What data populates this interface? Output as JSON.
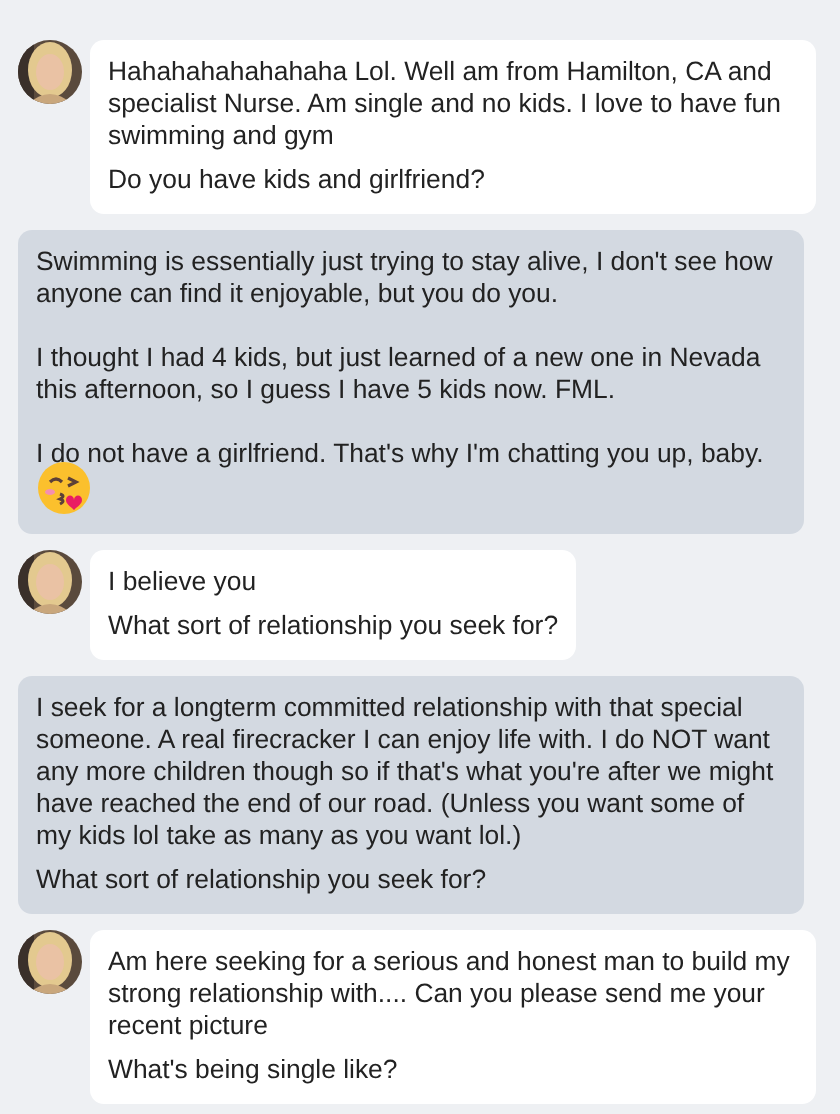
{
  "messages": [
    {
      "kind": "incoming",
      "paragraphs": [
        "Hahahahahahahaha Lol. Well am from Hamilton, CA and specialist Nurse. Am single and no kids. I love to have fun swimming and gym"
      ],
      "question": "Do you have kids and girlfriend?"
    },
    {
      "kind": "outgoing",
      "paragraphs": [
        "Swimming is essentially just trying to stay alive, I don't see how anyone can find it enjoyable, but you do you.",
        "I thought I had 4 kids, but just learned of a new one in Nevada this afternoon, so I guess I have 5 kids now. FML.",
        "I do not have a girlfriend. That's why I'm chatting you up, baby."
      ],
      "has_emoji": true
    },
    {
      "kind": "incoming",
      "paragraphs": [
        "I believe you"
      ],
      "question": "What sort of relationship you seek for?"
    },
    {
      "kind": "outgoing",
      "paragraphs": [
        "I seek for a longterm committed relationship with that special someone. A real firecracker I can enjoy life with. I do NOT want any more children though so if that's what you're after we might have reached the end of our road. (Unless you want some of my kids lol take as many as you want lol.)"
      ],
      "question": "What sort of relationship you seek for?"
    },
    {
      "kind": "incoming",
      "paragraphs": [
        "Am here seeking for a serious and honest man to build my strong relationship with.... Can you please send me your recent picture"
      ],
      "question": "What's being single like?"
    }
  ]
}
